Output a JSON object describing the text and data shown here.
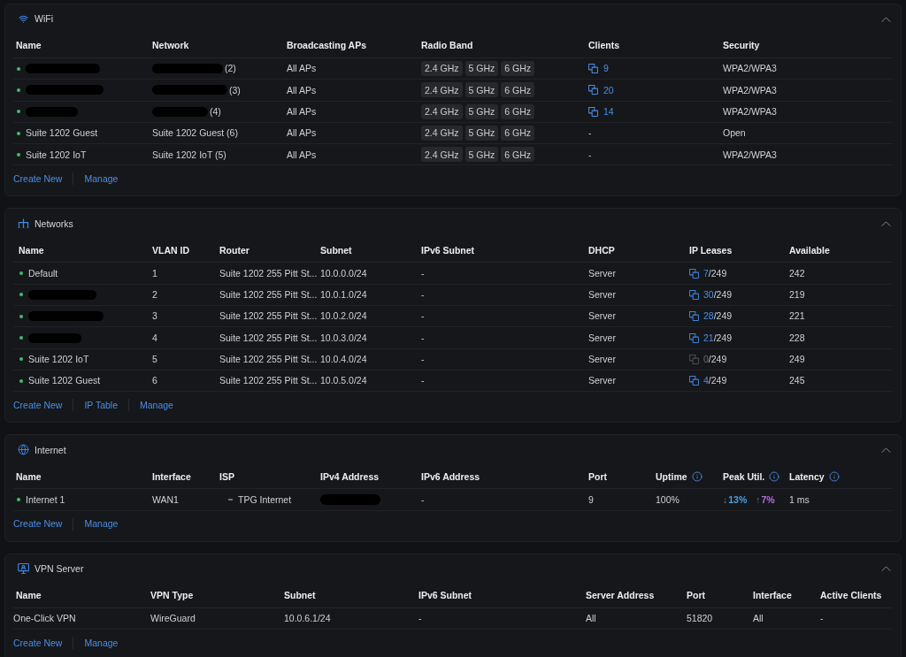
{
  "wifi": {
    "title": "WiFi",
    "expanded": true,
    "columns": [
      "Name",
      "Network",
      "Broadcasting APs",
      "Radio Band",
      "Clients",
      "Security"
    ],
    "rows": [
      {
        "online": true,
        "name_redacted": true,
        "network_redacted": true,
        "network": "(2)",
        "broadcasting_aps": "All APs",
        "radio_bands": [
          "2.4 GHz",
          "5 GHz",
          "6 GHz"
        ],
        "clients": "9",
        "clients_linked": true,
        "security": "WPA2/WPA3"
      },
      {
        "online": true,
        "name_redacted": true,
        "network_redacted": true,
        "network": "(3)",
        "broadcasting_aps": "All APs",
        "radio_bands": [
          "2.4 GHz",
          "5 GHz",
          "6 GHz"
        ],
        "clients": "20",
        "clients_linked": true,
        "security": "WPA2/WPA3"
      },
      {
        "online": true,
        "name_redacted": true,
        "network_redacted": true,
        "network": "(4)",
        "broadcasting_aps": "All APs",
        "radio_bands": [
          "2.4 GHz",
          "5 GHz",
          "6 GHz"
        ],
        "clients": "14",
        "clients_linked": true,
        "security": "WPA2/WPA3"
      },
      {
        "online": true,
        "name_redacted": false,
        "name": "Suite 1202 Guest",
        "network_redacted": false,
        "network": "Suite 1202 Guest (6)",
        "broadcasting_aps": "All APs",
        "radio_bands": [
          "2.4 GHz",
          "5 GHz",
          "6 GHz"
        ],
        "clients": "-",
        "clients_linked": false,
        "security": "Open"
      },
      {
        "online": true,
        "name_redacted": false,
        "name": "Suite 1202 IoT",
        "network_redacted": false,
        "network": "Suite 1202 IoT (5)",
        "broadcasting_aps": "All APs",
        "radio_bands": [
          "2.4 GHz",
          "5 GHz",
          "6 GHz"
        ],
        "clients": "-",
        "clients_linked": false,
        "security": "WPA2/WPA3"
      }
    ],
    "actions": [
      "Create New",
      "Manage"
    ]
  },
  "networks": {
    "title": "Networks",
    "expanded": true,
    "columns": [
      "Name",
      "VLAN ID",
      "Router",
      "Subnet",
      "IPv6 Subnet",
      "DHCP",
      "IP Leases",
      "Available"
    ],
    "rows": [
      {
        "online": true,
        "name_redacted": false,
        "name": "Default",
        "vlan_id": "1",
        "router": "Suite 1202 255 Pitt St...",
        "subnet": "10.0.0.0/24",
        "ipv6_subnet": "-",
        "dhcp": "Server",
        "leases": {
          "used": "7",
          "limit": "/249",
          "active": true
        },
        "available": "242"
      },
      {
        "online": true,
        "name_redacted": true,
        "vlan_id": "2",
        "router": "Suite 1202 255 Pitt St...",
        "subnet": "10.0.1.0/24",
        "ipv6_subnet": "-",
        "dhcp": "Server",
        "leases": {
          "used": "30",
          "limit": "/249",
          "active": true
        },
        "available": "219"
      },
      {
        "online": true,
        "name_redacted": true,
        "vlan_id": "3",
        "router": "Suite 1202 255 Pitt St...",
        "subnet": "10.0.2.0/24",
        "ipv6_subnet": "-",
        "dhcp": "Server",
        "leases": {
          "used": "28",
          "limit": "/249",
          "active": true
        },
        "available": "221"
      },
      {
        "online": true,
        "name_redacted": true,
        "vlan_id": "4",
        "router": "Suite 1202 255 Pitt St...",
        "subnet": "10.0.3.0/24",
        "ipv6_subnet": "-",
        "dhcp": "Server",
        "leases": {
          "used": "21",
          "limit": "/249",
          "active": true
        },
        "available": "228"
      },
      {
        "online": true,
        "name_redacted": false,
        "name": "Suite 1202 IoT",
        "vlan_id": "5",
        "router": "Suite 1202 255 Pitt St...",
        "subnet": "10.0.4.0/24",
        "ipv6_subnet": "-",
        "dhcp": "Server",
        "leases": {
          "used": "0",
          "limit": "/249",
          "active": false
        },
        "available": "249"
      },
      {
        "online": true,
        "name_redacted": false,
        "name": "Suite 1202 Guest",
        "vlan_id": "6",
        "router": "Suite 1202 255 Pitt St...",
        "subnet": "10.0.5.0/24",
        "ipv6_subnet": "-",
        "dhcp": "Server",
        "leases": {
          "used": "4",
          "limit": "/249",
          "active": true
        },
        "available": "245"
      }
    ],
    "actions": [
      "Create New",
      "IP Table",
      "Manage"
    ]
  },
  "internet": {
    "title": "Internet",
    "expanded": true,
    "columns": [
      {
        "label": "Name",
        "info": false
      },
      {
        "label": "Interface",
        "info": false
      },
      {
        "label": "ISP",
        "info": false
      },
      {
        "label": "IPv4 Address",
        "info": false
      },
      {
        "label": "IPv6 Address",
        "info": false
      },
      {
        "label": "Port",
        "info": false
      },
      {
        "label": "Uptime",
        "info": true
      },
      {
        "label": "Peak Util.",
        "info": true
      },
      {
        "label": "Latency",
        "info": true
      }
    ],
    "rows": [
      {
        "online": true,
        "name": "Internet 1",
        "interface": "WAN1",
        "isp": "TPG Internet",
        "ipv4_redacted": true,
        "ipv6_address": "-",
        "port": "9",
        "uptime": "100%",
        "peak_util": [
          {
            "arrow": "↓",
            "value": "13%",
            "color": "#4a9fe3"
          },
          {
            "arrow": "↑",
            "value": "7%",
            "color": "#b46ee0"
          }
        ],
        "latency": "1 ms"
      }
    ],
    "actions": [
      "Create New",
      "Manage"
    ]
  },
  "vpn_server": {
    "title": "VPN Server",
    "expanded": true,
    "columns": [
      "Name",
      "VPN Type",
      "Subnet",
      "IPv6 Subnet",
      "Server Address",
      "Port",
      "Interface",
      "Active Clients"
    ],
    "rows": [
      {
        "name": "One-Click VPN",
        "vpn_type": "WireGuard",
        "subnet": "10.0.6.1/24",
        "ipv6_subnet": "-",
        "server_address": "All",
        "port": "51820",
        "interface": "All",
        "active_clients": "-"
      }
    ],
    "actions": [
      "Create New",
      "Manage"
    ]
  }
}
